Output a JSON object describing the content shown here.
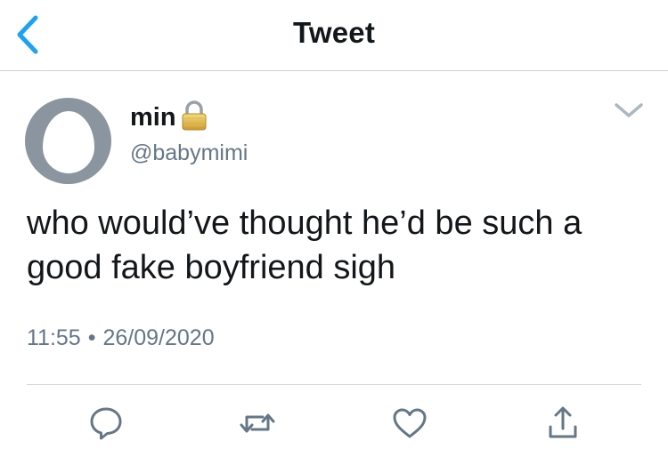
{
  "header": {
    "title": "Tweet",
    "back_icon": "chevron-left-icon"
  },
  "tweet": {
    "author": {
      "display_name": "min",
      "handle": "@babymimi",
      "protected_icon": "lock-icon",
      "avatar": "default-egg-avatar"
    },
    "text": "who would’ve thought he’d be such a good fake boyfriend sigh",
    "time": "11:55",
    "separator": "•",
    "date": "26/09/2020",
    "menu_icon": "chevron-down-icon"
  },
  "actions": [
    {
      "name": "reply",
      "icon": "reply-icon"
    },
    {
      "name": "retweet",
      "icon": "retweet-icon"
    },
    {
      "name": "like",
      "icon": "heart-icon"
    },
    {
      "name": "share",
      "icon": "share-icon"
    }
  ],
  "colors": {
    "accent": "#1da1f2",
    "text": "#14171a",
    "secondary": "#657786",
    "avatar": "#8a959f",
    "divider": "#cfd4d8"
  }
}
